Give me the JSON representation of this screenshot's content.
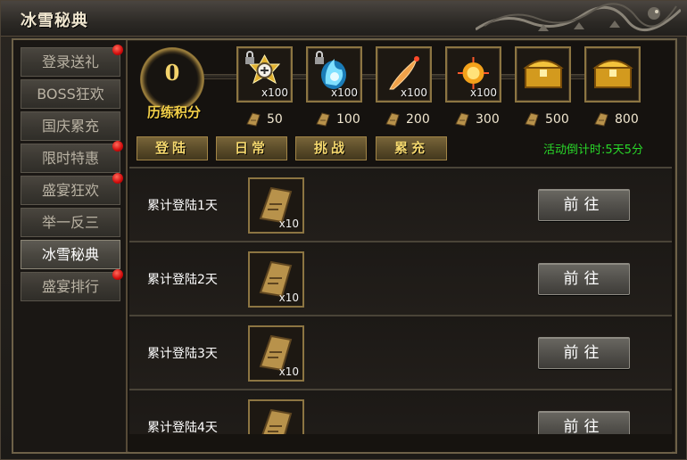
{
  "window": {
    "title": "冰雪秘典"
  },
  "sidebar": {
    "items": [
      {
        "label": "登录送礼",
        "badge": true,
        "active": false
      },
      {
        "label": "BOSS狂欢",
        "badge": false,
        "active": false
      },
      {
        "label": "国庆累充",
        "badge": false,
        "active": false
      },
      {
        "label": "限时特惠",
        "badge": true,
        "active": false
      },
      {
        "label": "盛宴狂欢",
        "badge": true,
        "active": false
      },
      {
        "label": "举一反三",
        "badge": false,
        "active": false
      },
      {
        "label": "冰雪秘典",
        "badge": false,
        "active": true
      },
      {
        "label": "盛宴排行",
        "badge": true,
        "active": false
      }
    ]
  },
  "score": {
    "value": "0",
    "label": "历练积分"
  },
  "rewards": [
    {
      "icon": "medal-badge-icon",
      "qty": "x100",
      "locked": true,
      "cost": "50"
    },
    {
      "icon": "blue-flame-icon",
      "qty": "x100",
      "locked": true,
      "cost": "100"
    },
    {
      "icon": "feather-blade-icon",
      "qty": "x100",
      "locked": false,
      "cost": "200"
    },
    {
      "icon": "gold-orb-icon",
      "qty": "x100",
      "locked": false,
      "cost": "300"
    },
    {
      "icon": "treasure-chest-icon",
      "qty": "",
      "locked": false,
      "cost": "500"
    },
    {
      "icon": "treasure-chest-icon",
      "qty": "",
      "locked": false,
      "cost": "800"
    }
  ],
  "tabs": [
    "登陆",
    "日常",
    "挑战",
    "累充"
  ],
  "countdown": "活动倒计时:5天5分",
  "tasks": [
    {
      "label": "累计登陆1天",
      "item_icon": "scroll-token-icon",
      "item_qty": "x10",
      "button": "前往"
    },
    {
      "label": "累计登陆2天",
      "item_icon": "scroll-token-icon",
      "item_qty": "x10",
      "button": "前往"
    },
    {
      "label": "累计登陆3天",
      "item_icon": "scroll-token-icon",
      "item_qty": "x10",
      "button": "前往"
    },
    {
      "label": "累计登陆4天",
      "item_icon": "scroll-token-icon",
      "item_qty": "",
      "button": "前往"
    }
  ],
  "colors": {
    "gold": "#f2cf48",
    "countdown_green": "#29d629",
    "badge_red": "#d10b0b"
  }
}
